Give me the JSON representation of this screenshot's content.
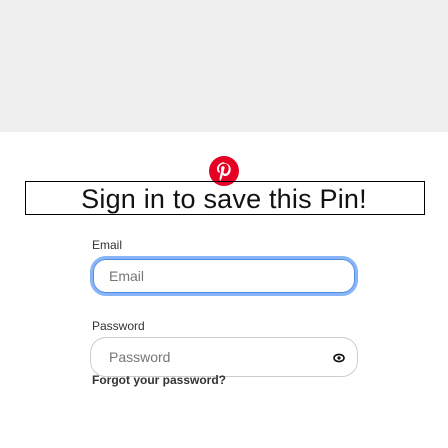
{
  "icons": {
    "logo": "pinterest-logo-icon",
    "password_toggle": "eye-icon"
  },
  "colors": {
    "brand": "#e60023",
    "focus_ring": "#8ab4f8",
    "top_band": "#efefef"
  },
  "title": "Sign in to save this Pin!",
  "email": {
    "label": "Email",
    "placeholder": "Email"
  },
  "password": {
    "label": "Password",
    "placeholder": "Password"
  },
  "forgot_link": "Forgot your password?"
}
